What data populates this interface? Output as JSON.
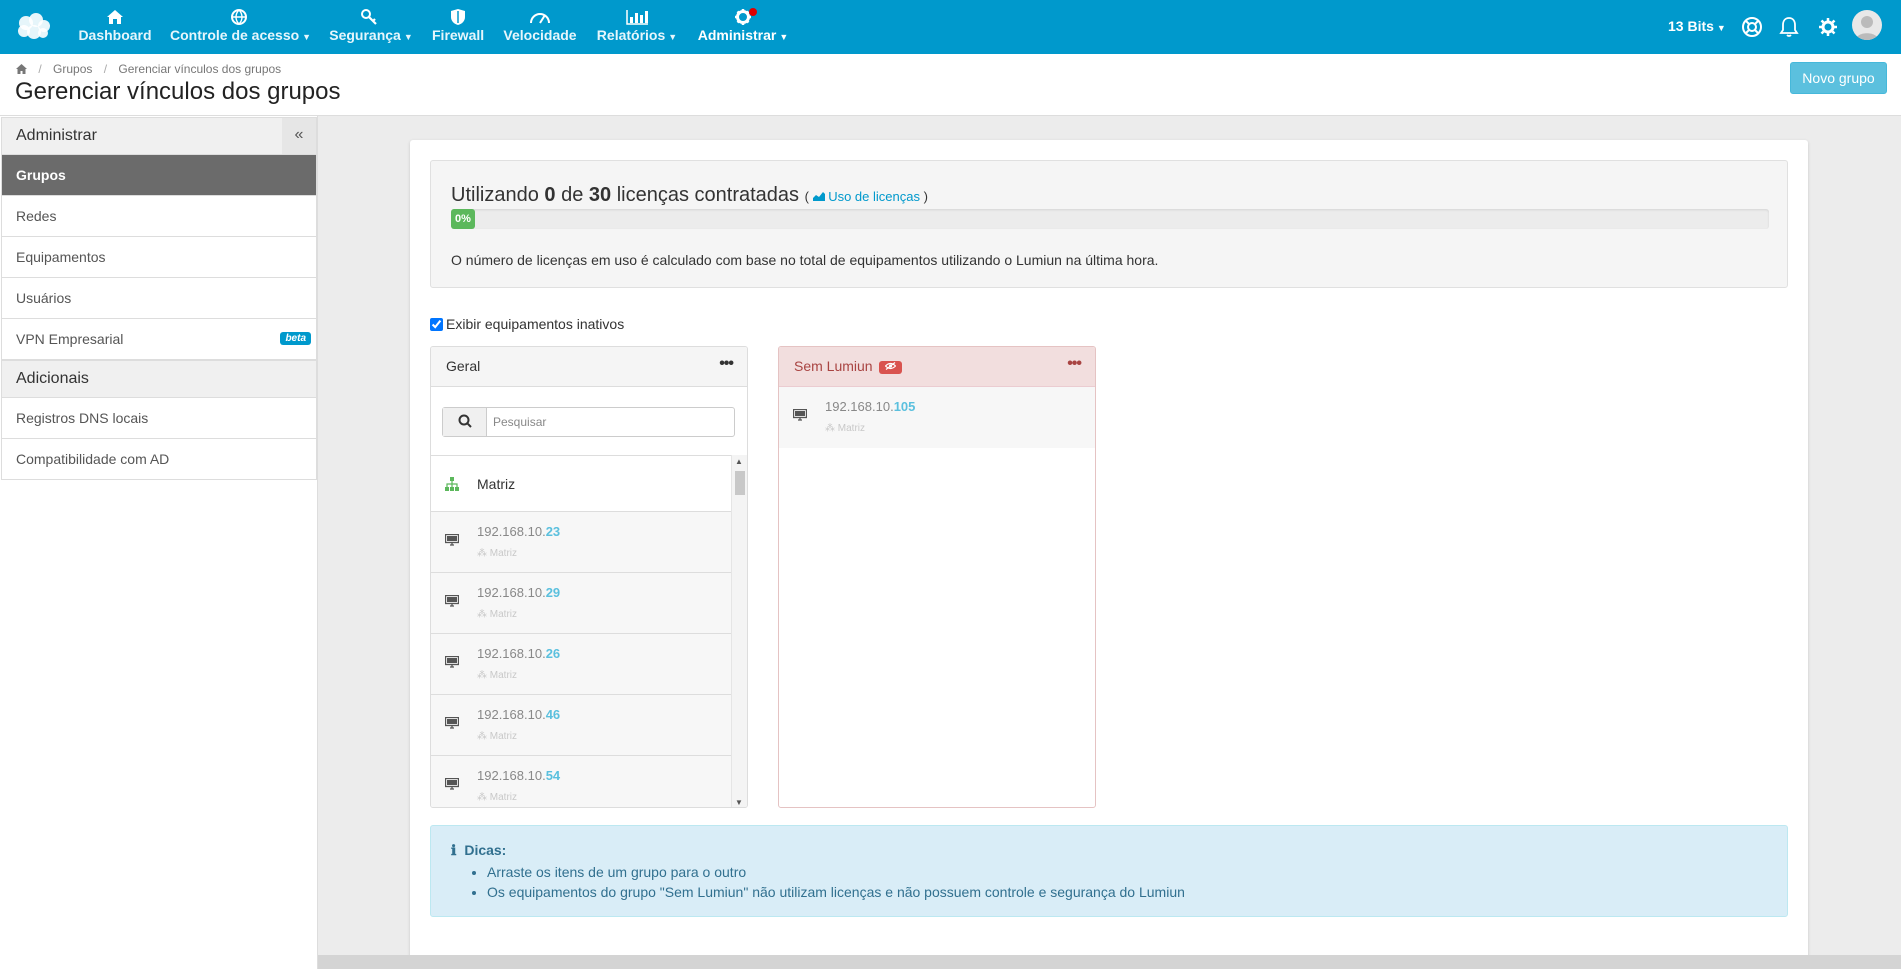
{
  "nav": {
    "items": [
      {
        "label": "Dashboard",
        "icon": "home-icon"
      },
      {
        "label": "Controle de acesso",
        "icon": "globe-icon"
      },
      {
        "label": "Segurança",
        "icon": "key-icon"
      },
      {
        "label": "Firewall",
        "icon": "shield-icon"
      },
      {
        "label": "Velocidade",
        "icon": "speedometer-icon"
      },
      {
        "label": "Relatórios",
        "icon": "bar-chart-icon"
      },
      {
        "label": "Administrar",
        "icon": "gear-icon"
      }
    ],
    "account": "13 Bits"
  },
  "breadcrumb": {
    "items": [
      "Grupos",
      "Gerenciar vínculos dos grupos"
    ]
  },
  "header": {
    "title": "Gerenciar vínculos dos grupos",
    "new_button": "Novo grupo"
  },
  "sidebar": {
    "section1": "Administrar",
    "collapse": "«",
    "items": [
      {
        "label": "Grupos"
      },
      {
        "label": "Redes"
      },
      {
        "label": "Equipamentos"
      },
      {
        "label": "Usuários"
      },
      {
        "label": "VPN Empresarial",
        "badge": "beta"
      }
    ],
    "section2": "Adicionais",
    "items2": [
      {
        "label": "Registros DNS locais"
      },
      {
        "label": "Compatibilidade com AD"
      }
    ]
  },
  "license": {
    "prefix": "Utilizando",
    "used": "0",
    "of": "de",
    "total": "30",
    "suffix": "licenças contratadas",
    "link_open": "(",
    "link_label": "Uso de licenças",
    "link_close": ")",
    "progress_label": "0%",
    "progress_value": 0,
    "note": "O número de licenças em uso é calculado com base no total de equipamentos utilizando o Lumiun na última hora."
  },
  "inactive_toggle": {
    "label": "Exibir equipamentos inativos",
    "checked": true
  },
  "groups": {
    "geral": {
      "title": "Geral",
      "menu": "•••",
      "search_placeholder": "Pesquisar",
      "group_item": "Matriz",
      "devices": [
        {
          "ip_prefix": "192.168.10.",
          "ip_suffix": "23",
          "group": "Matriz"
        },
        {
          "ip_prefix": "192.168.10.",
          "ip_suffix": "29",
          "group": "Matriz"
        },
        {
          "ip_prefix": "192.168.10.",
          "ip_suffix": "26",
          "group": "Matriz"
        },
        {
          "ip_prefix": "192.168.10.",
          "ip_suffix": "46",
          "group": "Matriz"
        },
        {
          "ip_prefix": "192.168.10.",
          "ip_suffix": "54",
          "group": "Matriz"
        }
      ]
    },
    "sem_lumiun": {
      "title": "Sem Lumiun",
      "menu": "•••",
      "devices": [
        {
          "ip_prefix": "192.168.10.",
          "ip_suffix": "105",
          "group": "Matriz"
        }
      ]
    }
  },
  "tips": {
    "title": "Dicas:",
    "items": [
      "Arraste os itens de um grupo para o outro",
      "Os equipamentos do grupo \"Sem Lumiun\" não utilizam licenças e não possuem controle e segurança do Lumiun"
    ]
  },
  "colors": {
    "brand": "#0099cc",
    "success": "#5cb85c",
    "danger": "#d9534f",
    "info": "#5bc0de"
  }
}
